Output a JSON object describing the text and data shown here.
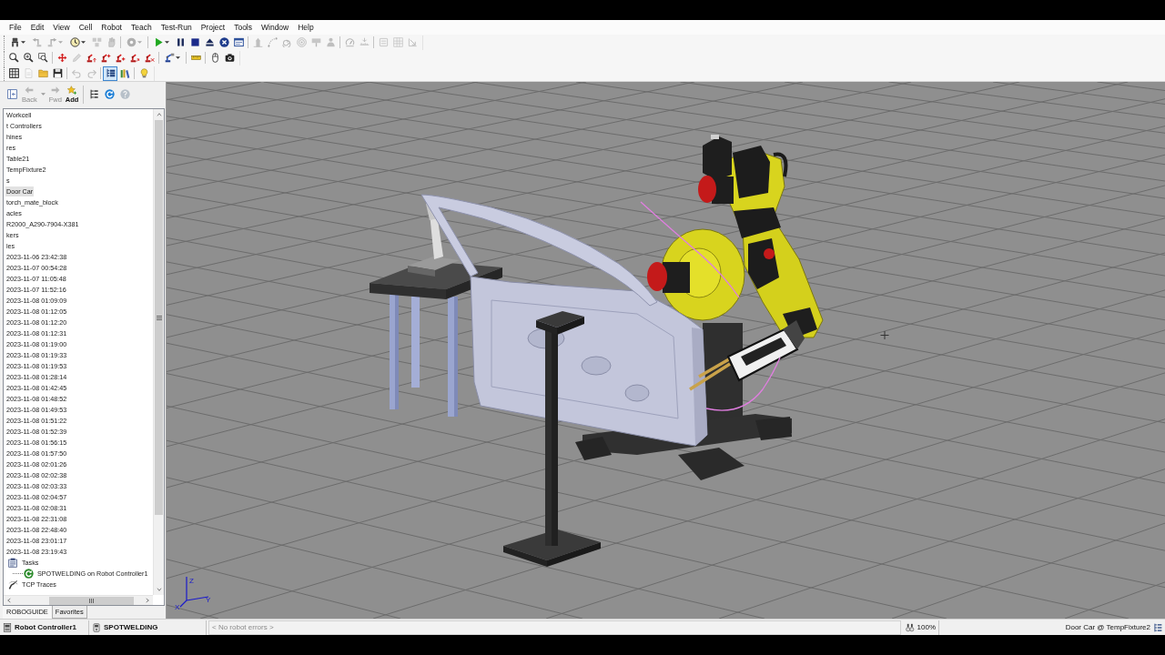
{
  "menu": [
    "File",
    "Edit",
    "View",
    "Cell",
    "Robot",
    "Teach",
    "Test-Run",
    "Project",
    "Tools",
    "Window",
    "Help"
  ],
  "toolbars": [
    {
      "groups": [
        [
          {
            "kind": "gripper",
            "dropdown": true,
            "disabled": false,
            "pressed": false
          },
          {
            "kind": "stepback",
            "disabled": true,
            "pressed": false
          },
          {
            "kind": "stepfwd",
            "dropdown": true,
            "disabled": true,
            "pressed": false
          },
          {
            "kind": "dial",
            "dropdown": true,
            "disabled": false,
            "pressed": false
          },
          {
            "kind": "blocks",
            "disabled": true,
            "pressed": false
          },
          {
            "kind": "hand",
            "disabled": true,
            "pressed": false
          }
        ],
        [
          {
            "kind": "disc",
            "dropdown": true,
            "disabled": true,
            "pressed": false
          }
        ],
        [
          {
            "kind": "play",
            "dropdown": true,
            "disabled": false,
            "pressed": false
          },
          {
            "kind": "pause",
            "disabled": false,
            "pressed": false
          },
          {
            "kind": "stop",
            "disabled": false,
            "pressed": false
          },
          {
            "kind": "eject",
            "disabled": false,
            "pressed": false
          },
          {
            "kind": "abort",
            "disabled": false,
            "pressed": false
          },
          {
            "kind": "panel",
            "disabled": false,
            "pressed": false
          }
        ],
        [
          {
            "kind": "tower",
            "disabled": true,
            "pressed": false
          },
          {
            "kind": "curve",
            "disabled": true,
            "pressed": false
          },
          {
            "kind": "spiral",
            "disabled": true,
            "pressed": false
          },
          {
            "kind": "target",
            "disabled": true,
            "pressed": false
          },
          {
            "kind": "board",
            "disabled": true,
            "pressed": false
          },
          {
            "kind": "person",
            "disabled": true,
            "pressed": false
          }
        ],
        [
          {
            "kind": "gauge",
            "disabled": true,
            "pressed": false
          },
          {
            "kind": "measure",
            "disabled": true,
            "pressed": false
          }
        ],
        [
          {
            "kind": "chip",
            "disabled": true,
            "pressed": false
          },
          {
            "kind": "grid",
            "disabled": true,
            "pressed": false
          },
          {
            "kind": "slope",
            "disabled": true,
            "pressed": false
          }
        ]
      ]
    },
    {
      "groups": [
        [
          {
            "kind": "zoomin",
            "disabled": false,
            "pressed": false
          },
          {
            "kind": "zoomout",
            "disabled": false,
            "pressed": false
          },
          {
            "kind": "zoomwin",
            "disabled": false,
            "pressed": false
          }
        ],
        [
          {
            "kind": "move",
            "disabled": false,
            "pressed": false
          },
          {
            "kind": "pencil",
            "disabled": true,
            "pressed": false
          },
          {
            "kind": "robotup",
            "disabled": false,
            "pressed": false
          },
          {
            "kind": "robotplus",
            "disabled": false,
            "pressed": false
          },
          {
            "kind": "robotin",
            "disabled": false,
            "pressed": false
          },
          {
            "kind": "robotjog",
            "disabled": false,
            "pressed": false
          },
          {
            "kind": "robotout",
            "disabled": false,
            "pressed": false
          }
        ],
        [
          {
            "kind": "robotblue",
            "dropdown": true,
            "disabled": false,
            "pressed": false
          }
        ],
        [
          {
            "kind": "ruler",
            "disabled": false,
            "pressed": false
          }
        ],
        [
          {
            "kind": "mouse",
            "disabled": false,
            "pressed": false
          },
          {
            "kind": "camera",
            "disabled": false,
            "pressed": false
          }
        ]
      ]
    },
    {
      "groups": [
        [
          {
            "kind": "table",
            "disabled": false,
            "pressed": false
          },
          {
            "kind": "doc",
            "disabled": true,
            "pressed": false
          },
          {
            "kind": "folder",
            "disabled": false,
            "pressed": false
          },
          {
            "kind": "save",
            "disabled": false,
            "pressed": false
          }
        ],
        [
          {
            "kind": "undo",
            "disabled": true,
            "pressed": false
          },
          {
            "kind": "redo",
            "disabled": true,
            "pressed": false
          }
        ],
        [
          {
            "kind": "tree",
            "disabled": false,
            "pressed": true
          },
          {
            "kind": "books",
            "disabled": false,
            "pressed": false
          }
        ],
        [
          {
            "kind": "bulb",
            "disabled": false,
            "pressed": false
          }
        ]
      ]
    }
  ],
  "navigator": {
    "groups": [
      [
        {
          "kind": "dock",
          "disabled": false
        },
        {
          "kind": "back",
          "label": "Back",
          "dropdown": true,
          "disabled": true
        },
        {
          "kind": "forward",
          "label": "Fwd",
          "disabled": true
        },
        {
          "kind": "add",
          "label": "Add",
          "disabled": false
        }
      ],
      [
        {
          "kind": "treenav",
          "disabled": false
        },
        {
          "kind": "refresh",
          "disabled": false
        },
        {
          "kind": "help",
          "disabled": true
        }
      ]
    ]
  },
  "tree": {
    "items": [
      {
        "label": "Workcell",
        "kind": "item",
        "selected": false
      },
      {
        "label": "t Controllers",
        "kind": "item",
        "selected": false
      },
      {
        "label": "hines",
        "kind": "item",
        "selected": false
      },
      {
        "label": "res",
        "kind": "item",
        "selected": false
      },
      {
        "label": "Table21",
        "kind": "item",
        "selected": false
      },
      {
        "label": "TempFixture2",
        "kind": "item",
        "selected": false
      },
      {
        "label": "s",
        "kind": "item",
        "selected": false
      },
      {
        "label": "Door Car",
        "kind": "item",
        "selected": true
      },
      {
        "label": "torch_mate_block",
        "kind": "item",
        "selected": false
      },
      {
        "label": "acles",
        "kind": "item",
        "selected": false
      },
      {
        "label": "R2000_A290-7904-X381",
        "kind": "item",
        "selected": false
      },
      {
        "label": "kers",
        "kind": "item",
        "selected": false
      },
      {
        "label": "les",
        "kind": "item",
        "selected": false
      },
      {
        "label": "2023-11-06 23:42:38",
        "kind": "item",
        "selected": false
      },
      {
        "label": "2023-11-07 00:54:28",
        "kind": "item",
        "selected": false
      },
      {
        "label": "2023-11-07 11:05:48",
        "kind": "item",
        "selected": false
      },
      {
        "label": "2023-11-07 11:52:16",
        "kind": "item",
        "selected": false
      },
      {
        "label": "2023-11-08 01:09:09",
        "kind": "item",
        "selected": false
      },
      {
        "label": "2023-11-08 01:12:05",
        "kind": "item",
        "selected": false
      },
      {
        "label": "2023-11-08 01:12:20",
        "kind": "item",
        "selected": false
      },
      {
        "label": "2023-11-08 01:12:31",
        "kind": "item",
        "selected": false
      },
      {
        "label": "2023-11-08 01:19:00",
        "kind": "item",
        "selected": false
      },
      {
        "label": "2023-11-08 01:19:33",
        "kind": "item",
        "selected": false
      },
      {
        "label": "2023-11-08 01:19:53",
        "kind": "item",
        "selected": false
      },
      {
        "label": "2023-11-08 01:28:14",
        "kind": "item",
        "selected": false
      },
      {
        "label": "2023-11-08 01:42:45",
        "kind": "item",
        "selected": false
      },
      {
        "label": "2023-11-08 01:48:52",
        "kind": "item",
        "selected": false
      },
      {
        "label": "2023-11-08 01:49:53",
        "kind": "item",
        "selected": false
      },
      {
        "label": "2023-11-08 01:51:22",
        "kind": "item",
        "selected": false
      },
      {
        "label": "2023-11-08 01:52:39",
        "kind": "item",
        "selected": false
      },
      {
        "label": "2023-11-08 01:56:15",
        "kind": "item",
        "selected": false
      },
      {
        "label": "2023-11-08 01:57:50",
        "kind": "item",
        "selected": false
      },
      {
        "label": "2023-11-08 02:01:26",
        "kind": "item",
        "selected": false
      },
      {
        "label": "2023-11-08 02:02:38",
        "kind": "item",
        "selected": false
      },
      {
        "label": "2023-11-08 02:03:33",
        "kind": "item",
        "selected": false
      },
      {
        "label": "2023-11-08 02:04:57",
        "kind": "item",
        "selected": false
      },
      {
        "label": "2023-11-08 02:08:31",
        "kind": "item",
        "selected": false
      },
      {
        "label": "2023-11-08 22:31:08",
        "kind": "item",
        "selected": false
      },
      {
        "label": "2023-11-08 22:48:40",
        "kind": "item",
        "selected": false
      },
      {
        "label": "2023-11-08 23:01:17",
        "kind": "item",
        "selected": false
      },
      {
        "label": "2023-11-08 23:19:43",
        "kind": "item",
        "selected": false
      },
      {
        "label": "Tasks",
        "kind": "tasks",
        "selected": false,
        "children": [
          {
            "label": "SPOTWELDING on Robot Controller1",
            "kind": "program",
            "selected": false
          }
        ]
      },
      {
        "label": "TCP Traces",
        "kind": "traces",
        "selected": false
      }
    ]
  },
  "panel_tabs": [
    {
      "label": "ROBOGUIDE",
      "selected": true
    },
    {
      "label": "Favorites",
      "selected": false
    }
  ],
  "viewport": {
    "axis_labels": [
      "Z",
      "Y",
      "X"
    ]
  },
  "status_bar": [
    {
      "kind": "controller",
      "text": "Robot Controller1"
    },
    {
      "kind": "program",
      "text": "SPOTWELDING"
    },
    {
      "kind": "message",
      "text": "< No robot errors >"
    },
    {
      "kind": "zoom",
      "text": "100%"
    },
    {
      "kind": "location",
      "text": "Door Car @ TempFixture2"
    }
  ]
}
